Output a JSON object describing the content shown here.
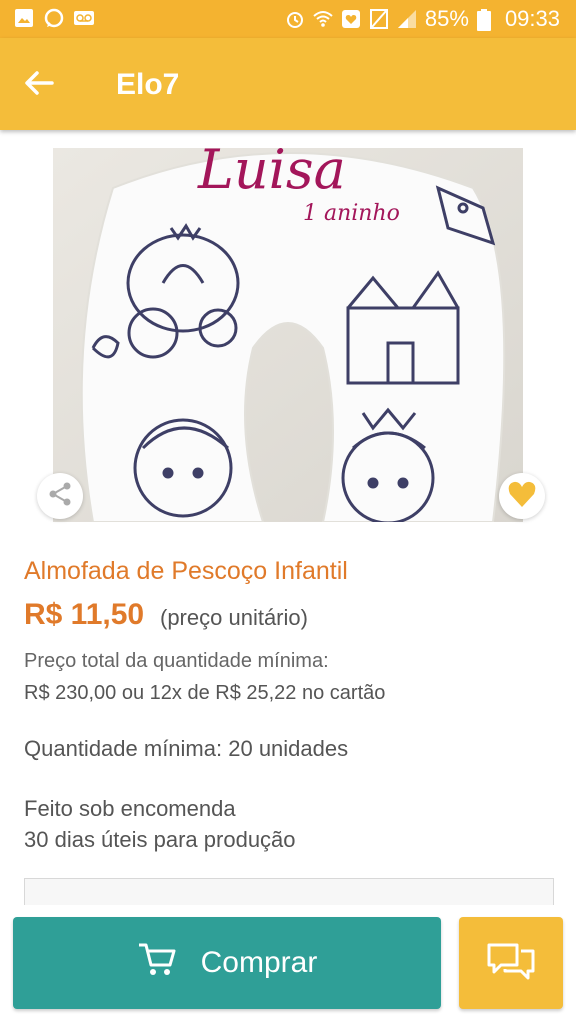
{
  "status_bar": {
    "battery": "85%",
    "time": "09:33",
    "icons": [
      "image-icon",
      "whatsapp-icon",
      "voicemail-icon",
      "alarm-icon",
      "wifi-icon",
      "heart-box-icon",
      "no-sim-icon",
      "signal-icon",
      "battery-icon"
    ]
  },
  "app_bar": {
    "title": "Elo7",
    "back_icon": "arrow-left-icon"
  },
  "product": {
    "image_text_name": "Luisa",
    "image_text_sub": "1 aninho",
    "title": "Almofada de Pescoço Infantil",
    "price": "R$ 11,50",
    "price_note": "(preço unitário)",
    "total_label": "Preço total da quantidade mínima:",
    "total_value": "R$ 230,00 ou 12x de R$ 25,22 no cartão",
    "min_qty_label": "Quantidade mínima:",
    "min_qty_value": "20 unidades",
    "made_to_order": "Feito sob encomenda",
    "production_time": "30 dias úteis para produção"
  },
  "actions": {
    "buy_label": "Comprar",
    "buy_icon": "cart-icon",
    "chat_icon": "chat-icon",
    "share_icon": "share-icon",
    "favorite_icon": "heart-icon"
  },
  "colors": {
    "status_bar": "#f4b330",
    "app_bar": "#f4bd3a",
    "accent": "#e07a2a",
    "buy_button": "#2f9f97",
    "favorite": "#f4bd3a"
  }
}
